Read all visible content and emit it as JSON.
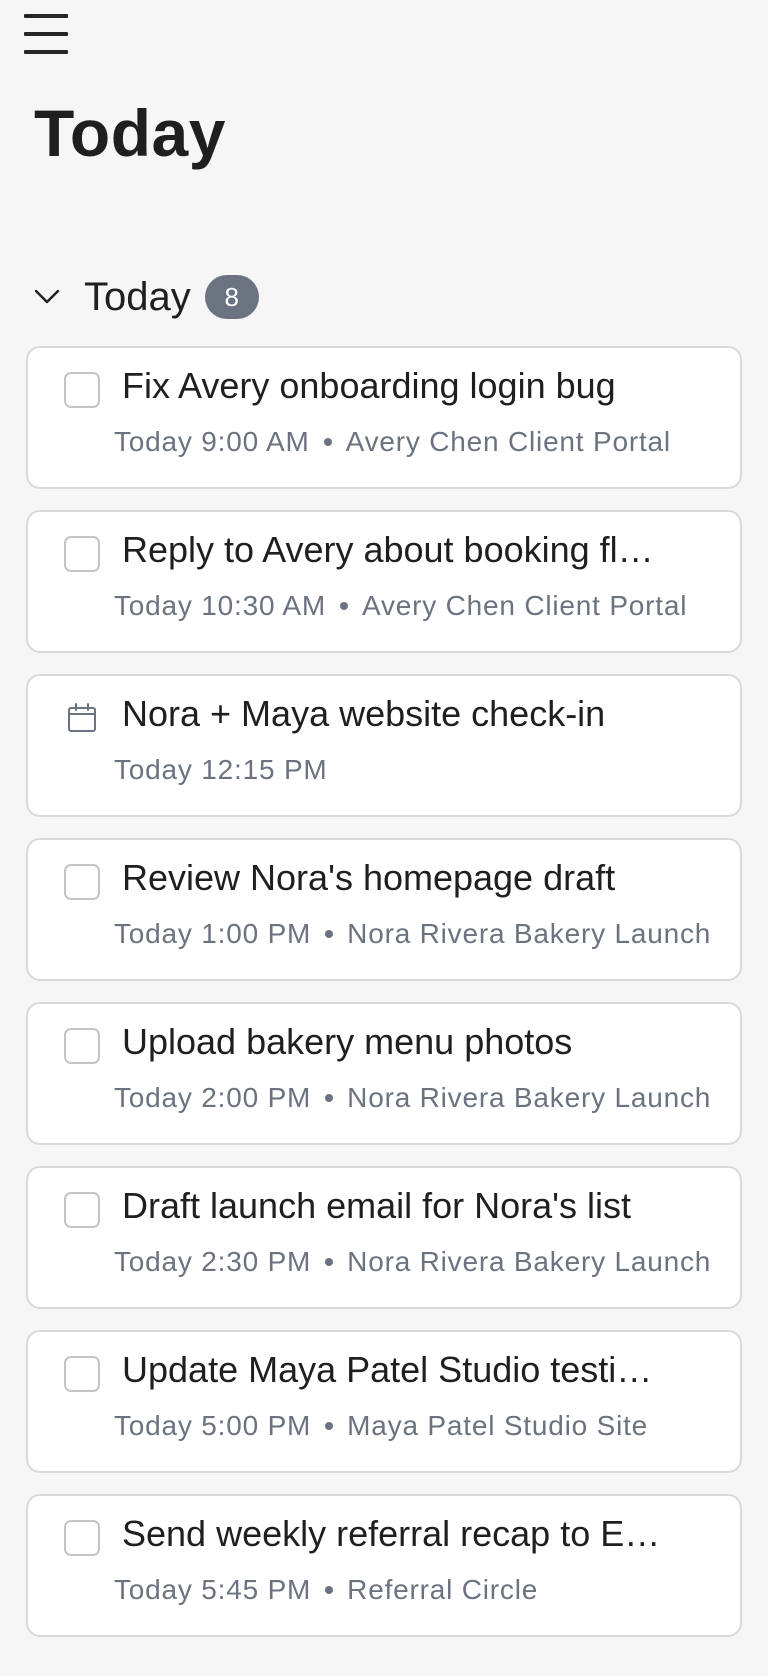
{
  "header": {
    "menu_icon": "hamburger-menu-icon",
    "page_title": "Today"
  },
  "section": {
    "title": "Today",
    "count": "8",
    "chevron_icon": "chevron-down-icon"
  },
  "tasks": [
    {
      "title": "Fix Avery onboarding login bug",
      "time": "Today 9:00 AM",
      "project": "Avery Chen Client Portal",
      "kind": "task"
    },
    {
      "title": "Reply to Avery about booking fl…",
      "time": "Today 10:30 AM",
      "project": "Avery Chen Client Portal",
      "kind": "task"
    },
    {
      "title": "Nora + Maya website check-in",
      "time": "Today 12:15 PM",
      "project": "",
      "kind": "event"
    },
    {
      "title": "Review Nora's homepage draft",
      "time": "Today 1:00 PM",
      "project": "Nora Rivera Bakery Launch",
      "kind": "task"
    },
    {
      "title": "Upload bakery menu photos",
      "time": "Today 2:00 PM",
      "project": "Nora Rivera Bakery Launch",
      "kind": "task"
    },
    {
      "title": "Draft launch email for Nora's list",
      "time": "Today 2:30 PM",
      "project": "Nora Rivera Bakery Launch",
      "kind": "task"
    },
    {
      "title": "Update Maya Patel Studio testi…",
      "time": "Today 5:00 PM",
      "project": "Maya Patel Studio Site",
      "kind": "task"
    },
    {
      "title": "Send weekly referral recap to E…",
      "time": "Today 5:45 PM",
      "project": "Referral Circle",
      "kind": "task"
    }
  ]
}
